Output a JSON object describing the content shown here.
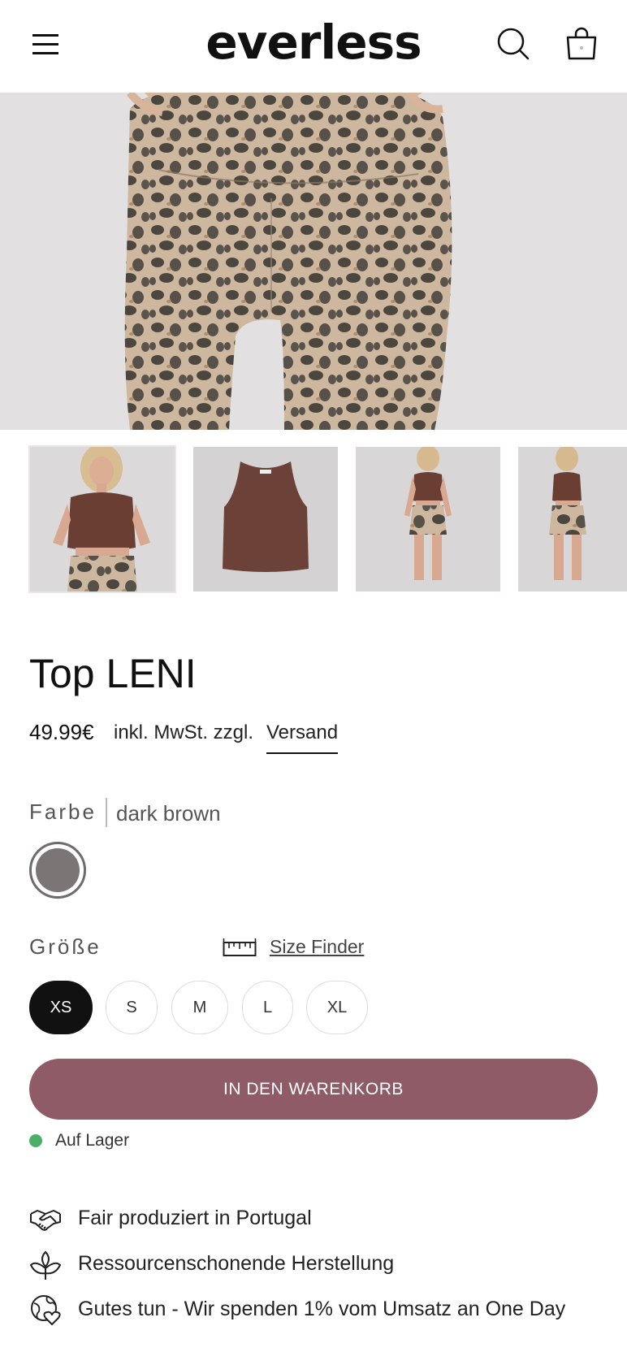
{
  "header": {
    "logo": "everless",
    "icons": [
      "hamburger-menu-icon",
      "search-icon",
      "shopping-bag-icon"
    ]
  },
  "gallery": {
    "hero_image": "leopard-print-shorts-photo",
    "thumbnails": [
      "model-front-top-leni",
      "product-flat-top-leni",
      "model-full-outfit",
      "model-full-outfit-side"
    ]
  },
  "product": {
    "title": "Top LENI",
    "price": "49.99€",
    "tax_note": "inkl. MwSt. zzgl.",
    "shipping_link": "Versand"
  },
  "color": {
    "label": "Farbe",
    "value": "dark brown",
    "swatch_hex": "#7b7576"
  },
  "size": {
    "label": "Größe",
    "finder_label": "Size Finder",
    "options": [
      "XS",
      "S",
      "M",
      "L",
      "XL"
    ],
    "selected": "XS"
  },
  "cart": {
    "button_label": "IN DEN WARENKORB",
    "accent": "#8e5b67"
  },
  "stock": {
    "text": "Auf Lager",
    "dot_color": "#4caf67"
  },
  "features": [
    {
      "icon": "handshake-icon",
      "text": "Fair produziert in Portugal"
    },
    {
      "icon": "leaf-plant-icon",
      "text": "Ressourcenschonende Herstellung"
    },
    {
      "icon": "heart-globe-icon",
      "text": "Gutes tun - Wir spenden 1% vom Umsatz an One Day"
    }
  ]
}
